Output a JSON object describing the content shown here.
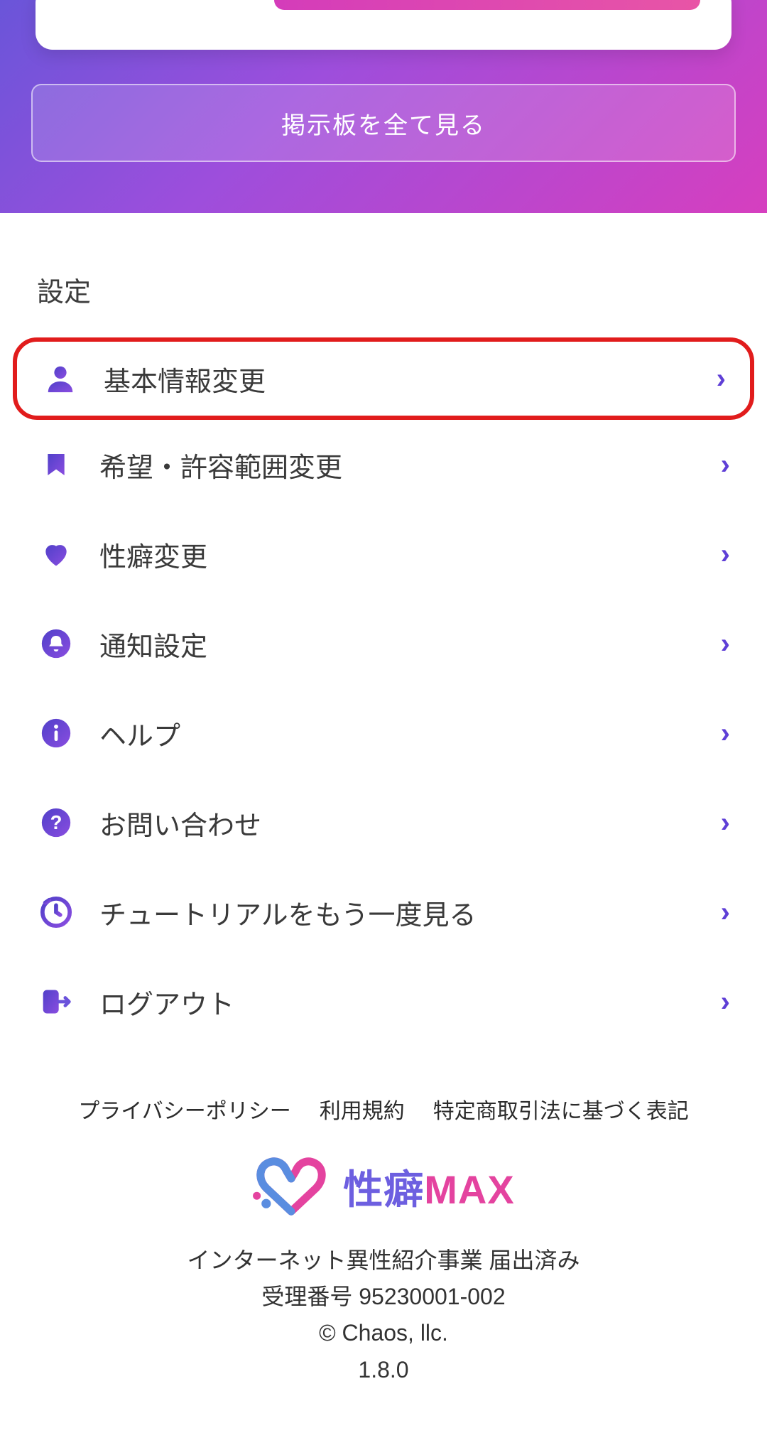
{
  "hero": {
    "see_all_label": "掲示板を全て見る"
  },
  "settings": {
    "title": "設定",
    "items": [
      {
        "icon": "person-icon",
        "label": "基本情報変更",
        "highlight": true
      },
      {
        "icon": "bookmark-icon",
        "label": "希望・許容範囲変更",
        "highlight": false
      },
      {
        "icon": "heart-icon",
        "label": "性癖変更",
        "highlight": false
      },
      {
        "icon": "bell-icon",
        "label": "通知設定",
        "highlight": false
      },
      {
        "icon": "info-icon",
        "label": "ヘルプ",
        "highlight": false
      },
      {
        "icon": "question-icon",
        "label": "お問い合わせ",
        "highlight": false
      },
      {
        "icon": "clock-icon",
        "label": "チュートリアルをもう一度見る",
        "highlight": false
      },
      {
        "icon": "logout-icon",
        "label": "ログアウト",
        "highlight": false
      }
    ]
  },
  "footer": {
    "links": [
      "プライバシーポリシー",
      "利用規約",
      "特定商取引法に基づく表記"
    ],
    "brand_a": "性癖",
    "brand_b": "MAX",
    "notice": "インターネット異性紹介事業 届出済み",
    "receipt": "受理番号 95230001-002",
    "copyright": "© Chaos, llc.",
    "version": "1.8.0"
  },
  "colors": {
    "accent_gradient_from": "#5040c9",
    "accent_gradient_to": "#8a4de0",
    "highlight_border": "#e11c1c"
  }
}
